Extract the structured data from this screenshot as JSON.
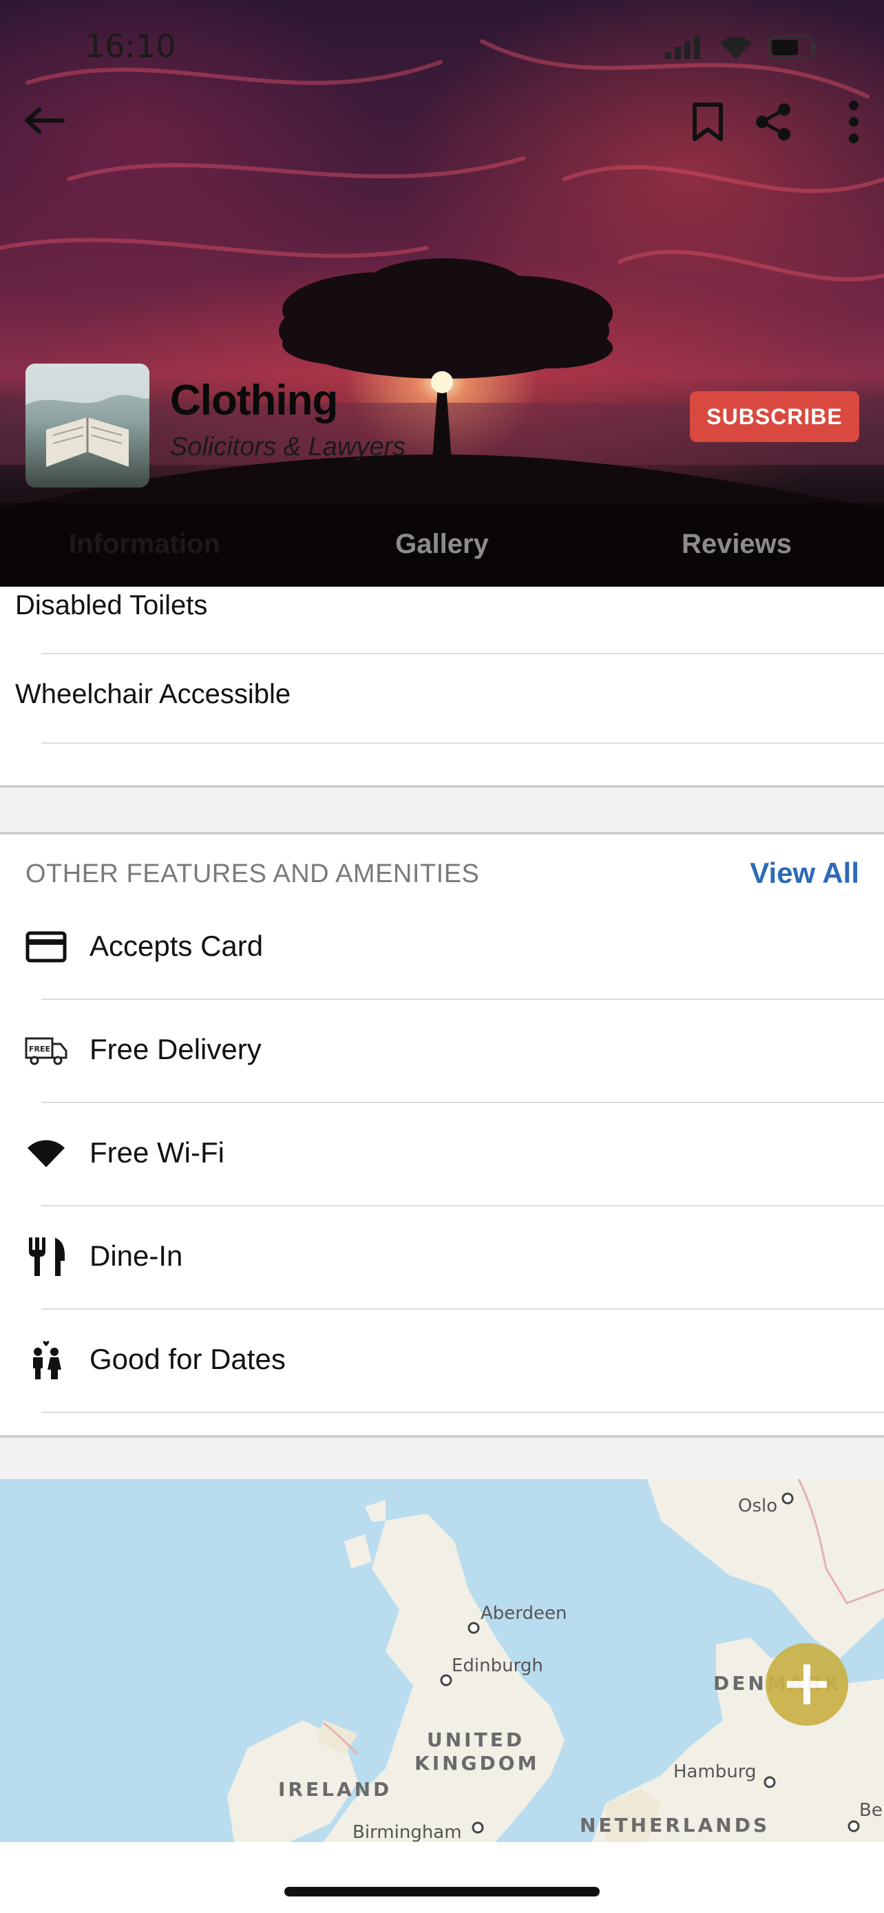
{
  "status_bar": {
    "time": "16:10"
  },
  "header": {
    "business_name": "Clothing",
    "category": "Solicitors & Lawyers",
    "subscribe_label": "SUBSCRIBE",
    "tabs": [
      "Information",
      "Gallery",
      "Reviews"
    ],
    "active_tab": "Information"
  },
  "accessibility_items": [
    "Disabled Toilets",
    "Wheelchair Accessible"
  ],
  "features": {
    "title": "OTHER FEATURES AND AMENITIES",
    "view_all": "View All",
    "items": [
      {
        "label": "Accepts Card",
        "icon": "credit-card-icon"
      },
      {
        "label": "Free Delivery",
        "icon": "delivery-truck-icon"
      },
      {
        "label": "Free Wi-Fi",
        "icon": "wifi-icon"
      },
      {
        "label": "Dine-In",
        "icon": "cutlery-icon"
      },
      {
        "label": "Good for Dates",
        "icon": "couple-icon"
      }
    ]
  },
  "map": {
    "places": [
      "Oslo",
      "Aberdeen",
      "Edinburgh",
      "Hamburg",
      "Birmingham",
      "Be"
    ],
    "countries": [
      "UNITED",
      "KINGDOM",
      "IRELAND",
      "NETHERLANDS",
      "DENMARK"
    ]
  },
  "colors": {
    "subscribe": "#d9493f",
    "link": "#2d6ab8",
    "map_water": "#b9dcef",
    "map_land": "#f1efe6",
    "fab": "#c9b146"
  }
}
